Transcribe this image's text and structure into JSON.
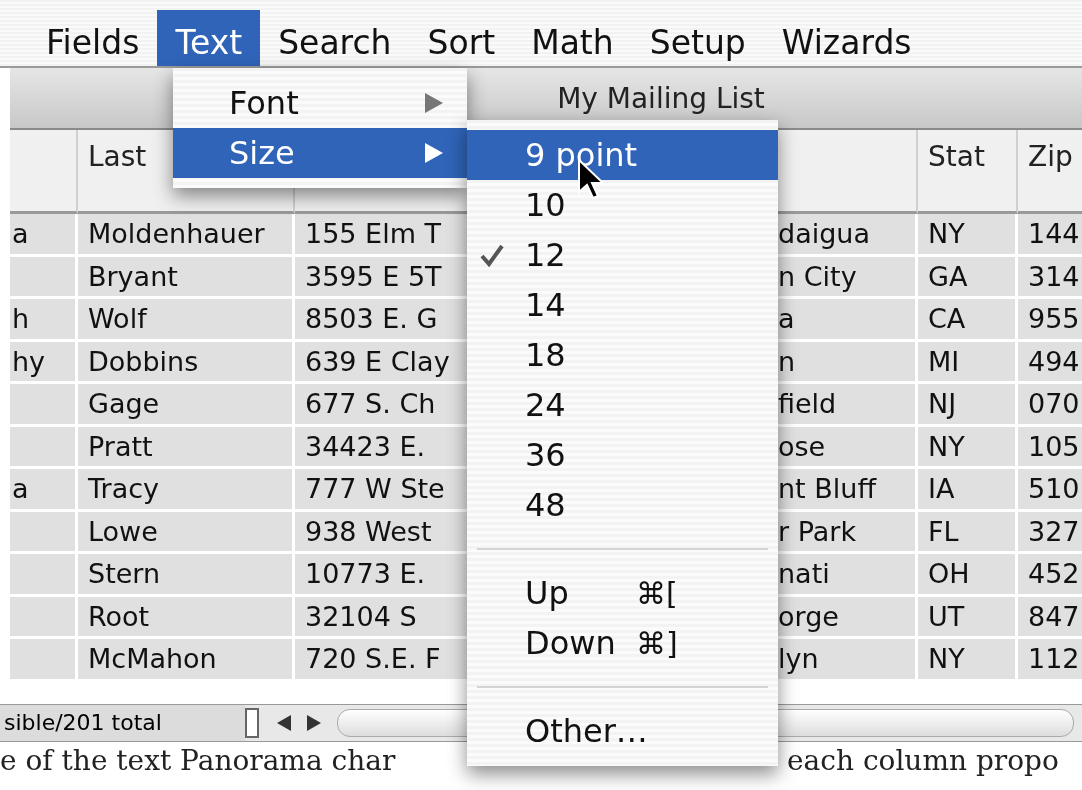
{
  "menu_bar": [
    {
      "label": "Fields",
      "selected": false
    },
    {
      "label": "Text",
      "selected": true
    },
    {
      "label": "Search",
      "selected": false
    },
    {
      "label": "Sort",
      "selected": false
    },
    {
      "label": "Math",
      "selected": false
    },
    {
      "label": "Setup",
      "selected": false
    },
    {
      "label": "Wizards",
      "selected": false
    }
  ],
  "window": {
    "title": "My Mailing List"
  },
  "table": {
    "header": {
      "last": "Last",
      "state": "Stat",
      "zip": "Zip"
    },
    "rows": [
      {
        "column_1": "a",
        "last": "Moldenhauer",
        "column_3": "155 Elm T",
        "column_4": "daigua",
        "state": "NY",
        "zip": "144"
      },
      {
        "last": "Bryant",
        "column_3": "3595 E 5T",
        "column_4": "n City",
        "state": "GA",
        "zip": "314"
      },
      {
        "column_1": "h",
        "last": "Wolf",
        "column_3": "8503 E. G",
        "column_4": "a",
        "state": "CA",
        "zip": "955"
      },
      {
        "column_1": "hy",
        "last": "Dobbins",
        "column_3": "639 E Clay",
        "column_4": "n",
        "state": "MI",
        "zip": "494"
      },
      {
        "last": "Gage",
        "column_3": "677 S. Ch",
        "column_4": "field",
        "state": "NJ",
        "zip": "070"
      },
      {
        "last": "Pratt",
        "column_3": "34423 E.",
        "column_4": "ose",
        "state": "NY",
        "zip": "105"
      },
      {
        "column_1": "a",
        "last": "Tracy",
        "column_3": "777 W Ste",
        "column_4": "nt Bluff",
        "state": "IA",
        "zip": "510"
      },
      {
        "last": "Lowe",
        "column_3": "938 West",
        "column_4": "r Park",
        "state": "FL",
        "zip": "327"
      },
      {
        "last": "Stern",
        "column_3": "10773 E.",
        "column_4": "nati",
        "state": "OH",
        "zip": "452"
      },
      {
        "last": "Root",
        "column_3": "32104 S",
        "column_4": "orge",
        "state": "UT",
        "zip": "847"
      },
      {
        "last": "McMahon",
        "column_3": "720 S.E. F",
        "column_4": "lyn",
        "state": "NY",
        "zip": "112"
      }
    ]
  },
  "status_bar": {
    "record_count": "sible/201 total"
  },
  "caption": {
    "left": "e of the text Panorama char",
    "right": "each column propo"
  },
  "text_menu": {
    "items": [
      {
        "label": "Font",
        "selected": false
      },
      {
        "label": "Size",
        "selected": true
      }
    ]
  },
  "size_submenu": {
    "items": [
      {
        "kind": "item",
        "label": "9 point",
        "selected": true,
        "checked": false
      },
      {
        "kind": "item",
        "label": "10",
        "selected": false,
        "checked": false
      },
      {
        "kind": "item",
        "label": "12",
        "selected": false,
        "checked": true
      },
      {
        "kind": "item",
        "label": "14",
        "selected": false,
        "checked": false
      },
      {
        "kind": "item",
        "label": "18",
        "selected": false,
        "checked": false
      },
      {
        "kind": "item",
        "label": "24",
        "selected": false,
        "checked": false
      },
      {
        "kind": "item",
        "label": "36",
        "selected": false,
        "checked": false
      },
      {
        "kind": "item",
        "label": "48",
        "selected": false,
        "checked": false
      },
      {
        "kind": "separator"
      },
      {
        "kind": "item",
        "label": "Up",
        "shortcut": "⌘[",
        "selected": false,
        "checked": false
      },
      {
        "kind": "item",
        "label": "Down",
        "shortcut": "⌘]",
        "selected": false,
        "checked": false
      },
      {
        "kind": "separator"
      },
      {
        "kind": "item",
        "label": "Other…",
        "selected": false,
        "checked": false
      }
    ]
  }
}
